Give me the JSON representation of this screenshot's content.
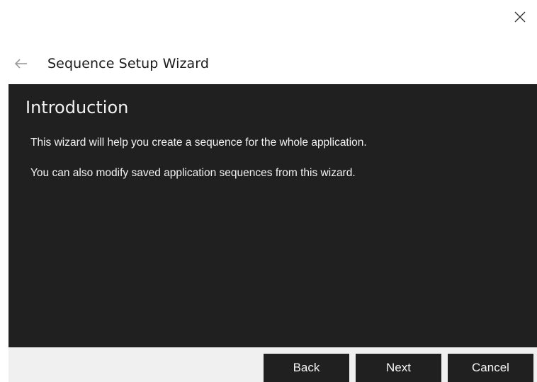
{
  "window": {
    "title": "Sequence Setup Wizard",
    "close_icon": "close-icon",
    "back_icon": "arrow-left-icon"
  },
  "content": {
    "heading": "Introduction",
    "lines": [
      "This wizard will help you create a sequence for the whole application.",
      "You can also modify saved application sequences from this wizard."
    ]
  },
  "footer": {
    "back_label": "Back",
    "next_label": "Next",
    "cancel_label": "Cancel"
  },
  "colors": {
    "content_bg": "#202020",
    "footer_bg": "#f0f0f0",
    "text_light": "#f2f2f2",
    "text_dark": "#1a1a1a"
  }
}
